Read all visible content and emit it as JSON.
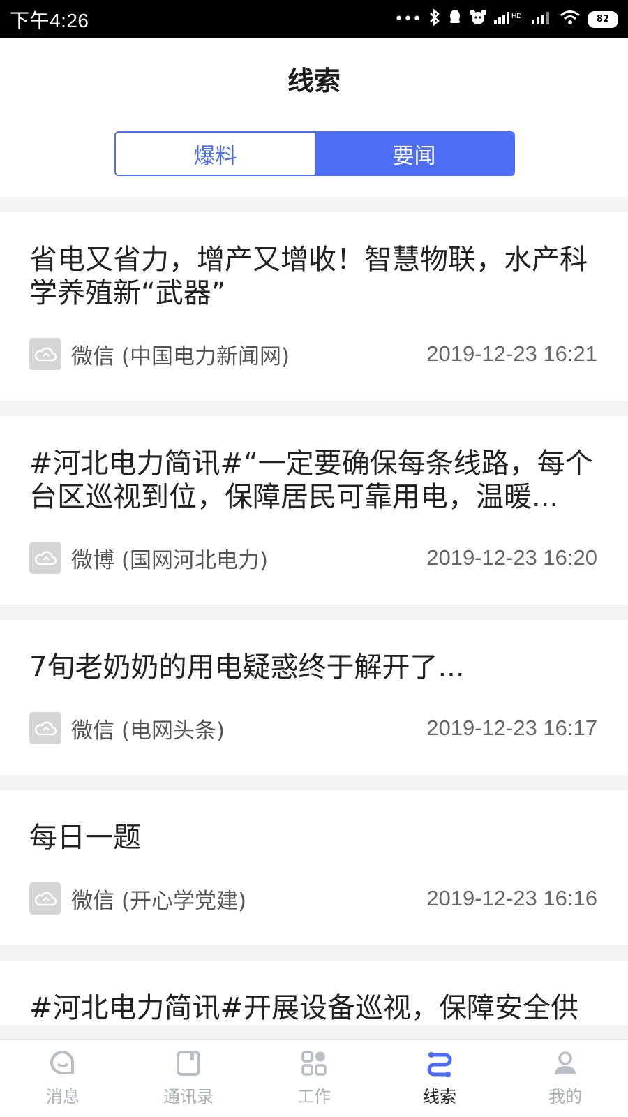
{
  "status_bar": {
    "time": "下午4:26",
    "battery": "82"
  },
  "header": {
    "title": "线索",
    "segments": [
      {
        "label": "爆料",
        "active": false
      },
      {
        "label": "要闻",
        "active": true
      }
    ]
  },
  "feed": [
    {
      "title": "省电又省力，增产又增收！智慧物联，水产科学养殖新“武器”",
      "source": "微信 (中国电力新闻网)",
      "time": "2019-12-23 16:21"
    },
    {
      "title": "#河北电力简讯#“一定要确保每条线路，每个台区巡视到位，保障居民可靠用电，温暖...",
      "source": "微博 (国网河北电力)",
      "time": "2019-12-23 16:20"
    },
    {
      "title": "7旬老奶奶的用电疑惑终于解开了...",
      "source": "微信 (电网头条)",
      "time": "2019-12-23 16:17"
    },
    {
      "title": "每日一题",
      "source": "微信 (开心学党建)",
      "time": "2019-12-23 16:16"
    },
    {
      "title": "#河北电力简讯#开展设备巡视，保障安全供",
      "source": "",
      "time": ""
    }
  ],
  "tab_bar": {
    "items": [
      {
        "label": "消息",
        "icon": "message-icon",
        "active": false
      },
      {
        "label": "通讯录",
        "icon": "contacts-icon",
        "active": false
      },
      {
        "label": "工作",
        "icon": "apps-grid-icon",
        "active": false
      },
      {
        "label": "线索",
        "icon": "clue-icon",
        "active": true
      },
      {
        "label": "我的",
        "icon": "person-icon",
        "active": false
      }
    ]
  },
  "colors": {
    "accent": "#4d6ef2",
    "inactive_tab": "#aab0b7"
  }
}
